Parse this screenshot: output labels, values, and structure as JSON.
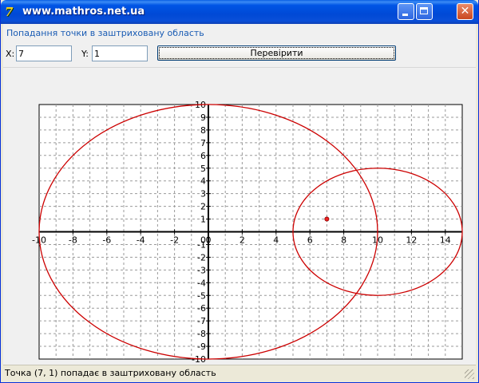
{
  "window": {
    "title": "www.mathros.net.ua",
    "icon": "app-icon"
  },
  "form": {
    "caption": "Попадання точки в заштриховану область",
    "x_label": "X:",
    "x_value": "7",
    "y_label": "Y:",
    "y_value": "1",
    "check_button": "Перевірити"
  },
  "status": {
    "text": "Точка (7, 1) попадає в заштриховану область"
  },
  "chart_data": {
    "type": "scatter",
    "xlim": [
      -10,
      15
    ],
    "ylim": [
      -10,
      10
    ],
    "x_ticks": [
      -10,
      -8,
      -6,
      -4,
      -2,
      0,
      2,
      4,
      6,
      8,
      10,
      12,
      14
    ],
    "y_ticks": [
      -10,
      -9,
      -8,
      -7,
      -6,
      -5,
      -4,
      -3,
      -2,
      -1,
      0,
      1,
      2,
      3,
      4,
      5,
      6,
      7,
      8,
      9,
      10
    ],
    "grid": true,
    "circles": [
      {
        "cx": 0,
        "cy": 0,
        "r": 10,
        "color": "#cc0000"
      },
      {
        "cx": 10,
        "cy": 0,
        "r": 5,
        "color": "#cc0000"
      }
    ],
    "point": {
      "x": 7,
      "y": 1,
      "color": "#ee2222"
    }
  }
}
